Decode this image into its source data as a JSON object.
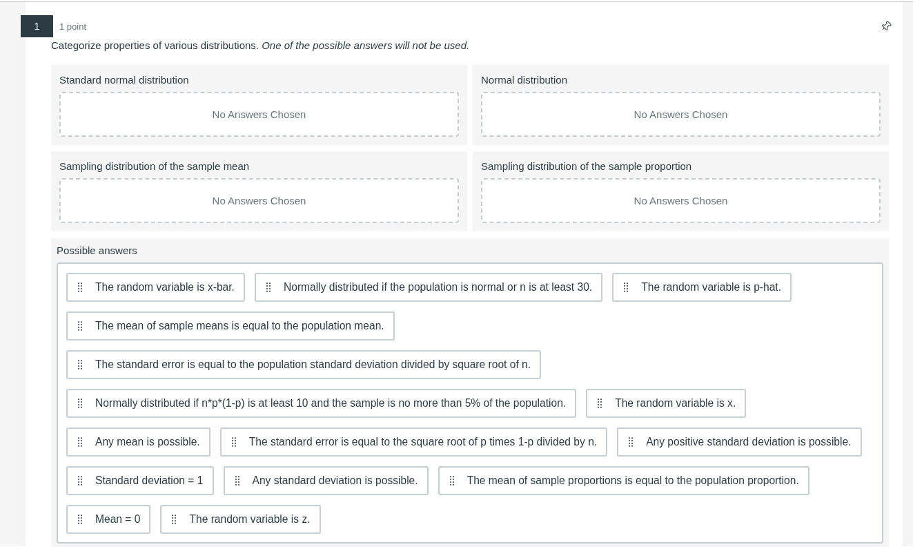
{
  "question": {
    "number": "1",
    "points": "1 point",
    "prompt": "Categorize properties of various distributions. *One of the possible answers will not be used.*"
  },
  "categories": [
    {
      "label": "Standard normal distribution",
      "placeholder": "No Answers Chosen"
    },
    {
      "label": "Normal distribution",
      "placeholder": "No Answers Chosen"
    },
    {
      "label": "Sampling distribution of the sample mean",
      "placeholder": "No Answers Chosen"
    },
    {
      "label": "Sampling distribution of the sample proportion",
      "placeholder": "No Answers Chosen"
    }
  ],
  "possible_answers": {
    "label": "Possible answers",
    "answers": [
      "The random variable is x-bar.",
      "Normally distributed if the population is normal or n is at least 30.",
      "The random variable is p-hat.",
      "The mean of sample means is equal to the population mean.",
      "The standard error is equal to the population standard deviation divided by square root of n.",
      "Normally distributed if n*p*(1-p) is at least 10 and the sample is no more than 5% of the population.",
      "The random variable is x.",
      "Any mean is possible.",
      "The standard error is equal to the square root of p times 1-p divided by n.",
      "Any positive standard deviation is possible.",
      "Standard deviation = 1",
      "Any standard deviation is possible.",
      "The mean of sample proportions is equal to the population proportion.",
      "Mean = 0",
      "The random variable is z."
    ]
  }
}
